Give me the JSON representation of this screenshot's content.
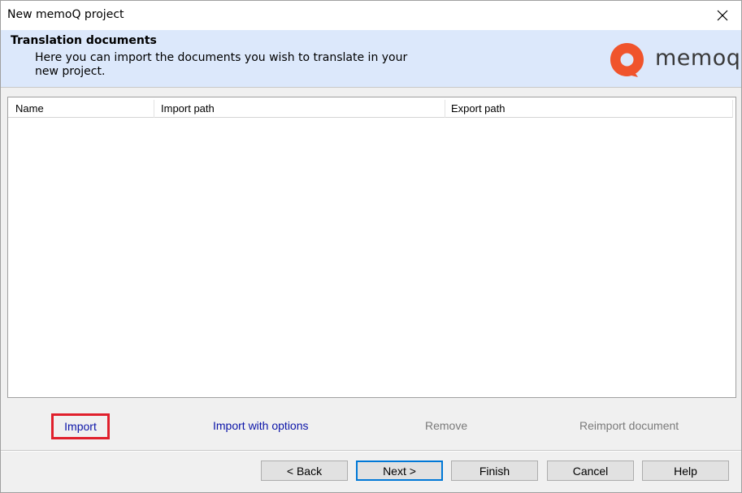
{
  "window": {
    "title": "New memoQ project"
  },
  "header": {
    "title": "Translation documents",
    "description": "Here you can import the documents you wish to translate in your new project.",
    "logo_text": "memoq",
    "logo_color": "#f0542c"
  },
  "documents_table": {
    "columns": [
      "Name",
      "Import path",
      "Export path"
    ],
    "rows": []
  },
  "actions": {
    "import": "Import",
    "import_with_options": "Import with options",
    "remove": "Remove",
    "reimport_document": "Reimport document"
  },
  "buttons": {
    "back": "< Back",
    "next": "Next >",
    "finish": "Finish",
    "cancel": "Cancel",
    "help": "Help"
  },
  "colors": {
    "header_bg": "#dce8fb",
    "link": "#0b14a8",
    "highlight": "#e0202c",
    "disabled": "#7a7a7a"
  }
}
